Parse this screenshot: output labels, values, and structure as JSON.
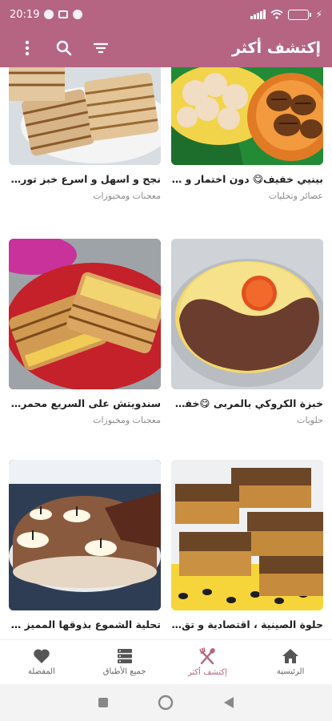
{
  "status_bar": {
    "time": "20:19",
    "battery_percent": 0.9
  },
  "app_bar": {
    "title": "إكتشف أكثر",
    "icons": [
      "more-vert-icon",
      "search-icon",
      "filter-icon"
    ]
  },
  "recipes": [
    {
      "title": "نجح و اسهل و اسرع خبز تورتي...",
      "category": "معجنات ومخبوزات"
    },
    {
      "title": "بينيي خفيف😋 دون اختمار و ...",
      "category": "عصائر وتحليات"
    },
    {
      "title": "سندويتش على السريع محمر ف...",
      "category": "معجنات ومخبوزات"
    },
    {
      "title": "خبزة الكروكي بالمربى 😋خفي...",
      "category": "حلويات"
    },
    {
      "title": "تحلية الشموع بذوقها المميز ، ال...",
      "category": ""
    },
    {
      "title": "حلوة الصينية ، اقتصادية و تق...",
      "category": ""
    }
  ],
  "bottom_nav": [
    {
      "label": "الرئيسية",
      "icon": "home-icon",
      "active": false
    },
    {
      "label": "إكتشف أكثر",
      "icon": "utensils-icon",
      "active": true
    },
    {
      "label": "جميع الأطباق",
      "icon": "list-icon",
      "active": false
    },
    {
      "label": "المفضلة",
      "icon": "heart-icon",
      "active": false
    }
  ],
  "system_nav": [
    "recents-button",
    "home-button",
    "back-button"
  ],
  "colors": {
    "primary": "#b56582",
    "battery": "#7be06a"
  }
}
